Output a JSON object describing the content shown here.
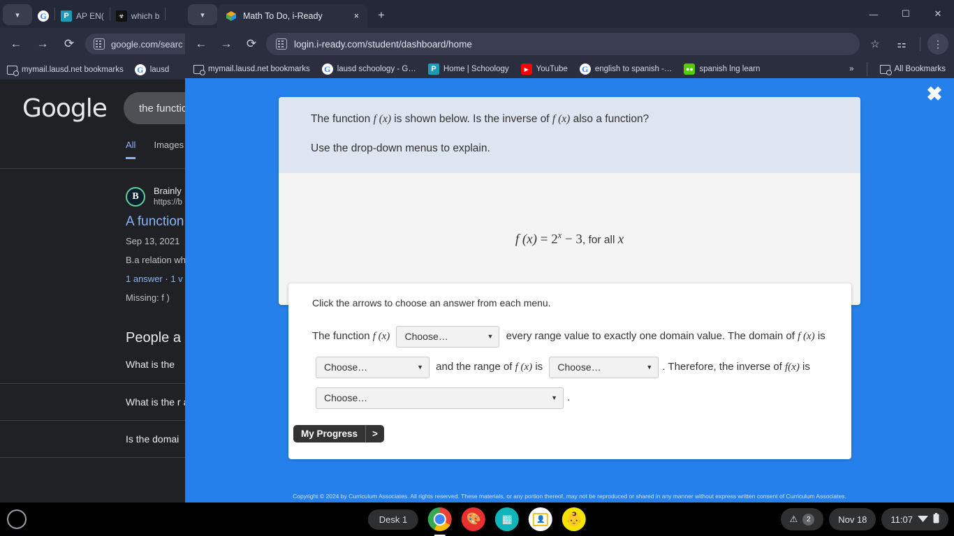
{
  "background_window": {
    "tabs": [
      {
        "favicon": "google-icon",
        "label": ""
      },
      {
        "favicon": "schoology-icon",
        "label": "AP EN("
      },
      {
        "favicon": "dark-icon",
        "label": "which b"
      }
    ],
    "omnibox_url": "google.com/searc",
    "bookmarks": [
      {
        "icon": "folder-gear-icon",
        "label": "mymail.lausd.net bookmarks"
      },
      {
        "icon": "google-icon",
        "label": "lausd"
      }
    ],
    "google": {
      "logo": "Google",
      "search_query": "the function",
      "tabs": [
        "All",
        "Images"
      ],
      "result": {
        "site": "Brainly",
        "url": "https://b",
        "title": "A function",
        "date": "Sep 13, 2021",
        "snippet": "B.a relation wh",
        "answers": "1 answer",
        "views": "1 v",
        "missing": "Missing: f )"
      },
      "people_also_ask_title": "People a",
      "people_also_ask": [
        "What is the ",
        "What is the r and its inver",
        "Is the domai"
      ]
    }
  },
  "front_window": {
    "tab": {
      "favicon": "cube-icon",
      "title": "Math To Do, i-Ready",
      "close": "×"
    },
    "new_tab_label": "+",
    "window_controls": {
      "minimize": "—",
      "maximize": "☐",
      "close": "✕"
    },
    "omnibox_url": "login.i-ready.com/student/dashboard/home",
    "toolbar_icons": [
      "bookmark-star-icon",
      "extensions-icon",
      "more-menu-icon"
    ],
    "bookmarks": [
      {
        "icon": "folder-gear-icon",
        "label": "mymail.lausd.net bookmarks"
      },
      {
        "icon": "google-icon",
        "label": "lausd schoology - G…"
      },
      {
        "icon": "schoology-icon",
        "label": "Home | Schoology"
      },
      {
        "icon": "youtube-icon",
        "label": "YouTube"
      },
      {
        "icon": "google-icon",
        "label": "english to spanish -…"
      },
      {
        "icon": "duolingo-icon",
        "label": "spanish lng learn"
      }
    ],
    "bookmarks_overflow": "»",
    "all_bookmarks_label": "All Bookmarks"
  },
  "iready": {
    "close_button": "✖",
    "question": {
      "line1_part1": "The function ",
      "line1_fx": "f (x)",
      "line1_part2": " is shown below. Is the inverse of ",
      "line1_fx2": "f (x)",
      "line1_part3": " also a function?",
      "line2": "Use the drop-down menus to explain.",
      "formula": "f (x) = 2ˣ − 3, for all x",
      "formula_parts": {
        "fx": "f (x)",
        "equals": " = ",
        "base": "2",
        "exp": "x",
        "rest": " − 3",
        "tail": ", for all ",
        "var": "x"
      }
    },
    "answer": {
      "instruction": "Click the arrows to choose an answer from each menu.",
      "text1": "The function ",
      "fx_a": "f (x)",
      "text2": " every range value to exactly one domain value. The domain of ",
      "fx_b": "f (x)",
      "text3": " is ",
      "text4": " and the range of ",
      "fx_c": "f (x)",
      "text5": " is ",
      "text6": ". Therefore, the inverse of ",
      "fx_d": "f(x)",
      "text7": " is ",
      "text8": ".",
      "dropdowns": [
        {
          "name": "dropdown-1",
          "value": "Choose…",
          "caret": "▼"
        },
        {
          "name": "dropdown-2",
          "value": "Choose…",
          "caret": "▼"
        },
        {
          "name": "dropdown-3",
          "value": "Choose…",
          "caret": "▼"
        },
        {
          "name": "dropdown-4",
          "value": "Choose…",
          "caret": "▼"
        }
      ],
      "tools": [
        {
          "name": "undo-icon",
          "glyph": "↩"
        },
        {
          "name": "trash-icon",
          "glyph": "🗑"
        }
      ]
    },
    "progress": {
      "label": "My Progress",
      "arrow": ">"
    },
    "copyright": "Copyright © 2024 by Curriculum Associates. All rights reserved. These materials, or any portion thereof, may not be reproduced or shared in any manner without express written consent of Curriculum Associates.",
    "colors": {
      "app_blue": "#2680eb",
      "header_blue": "#dde5f0",
      "body_gray": "#f4f4f4"
    }
  },
  "shelf": {
    "desk_label": "Desk 1",
    "apps": [
      {
        "name": "chrome-icon",
        "label": "Chrome"
      },
      {
        "name": "paint-icon",
        "label": "Paint"
      },
      {
        "name": "teal-app-icon",
        "label": "Slides"
      },
      {
        "name": "google-classroom-icon",
        "label": "Classroom"
      },
      {
        "name": "avatar-icon",
        "label": "Avatar"
      }
    ],
    "status": {
      "warning_glyph": "⚠",
      "notification_count": "2",
      "date": "Nov 18",
      "time": "11:07",
      "wifi_glyph": "▼",
      "battery_glyph": "▌"
    }
  }
}
